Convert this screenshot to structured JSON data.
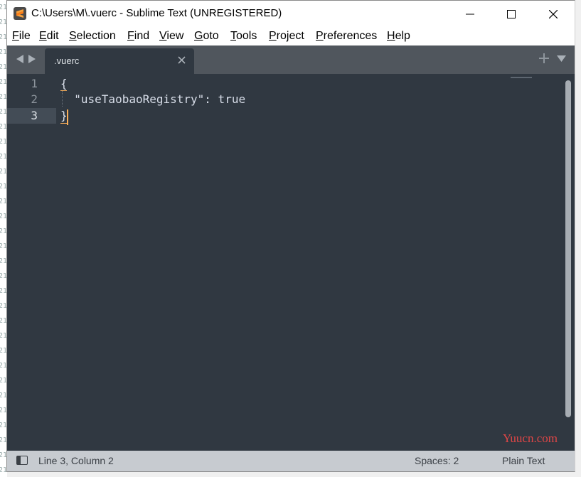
{
  "window": {
    "title": "C:\\Users\\M\\.vuerc - Sublime Text (UNREGISTERED)"
  },
  "menu": [
    "File",
    "Edit",
    "Selection",
    "Find",
    "View",
    "Goto",
    "Tools",
    "Project",
    "Preferences",
    "Help"
  ],
  "tabs": [
    {
      "label": ".vuerc"
    }
  ],
  "editor": {
    "lines": [
      "{",
      "  \"useTaobaoRegistry\": true",
      "}"
    ],
    "line_numbers": [
      "1",
      "2",
      "3"
    ],
    "current_line": 3
  },
  "status": {
    "position": "Line 3, Column 2",
    "indent": "Spaces: 2",
    "syntax": "Plain Text"
  },
  "watermark": "Yuucn.com",
  "colors": {
    "editor_bg": "#303841",
    "tab_bar": "#50565d",
    "caret": "#f9ae58",
    "status_bar": "#c7cbd0"
  }
}
